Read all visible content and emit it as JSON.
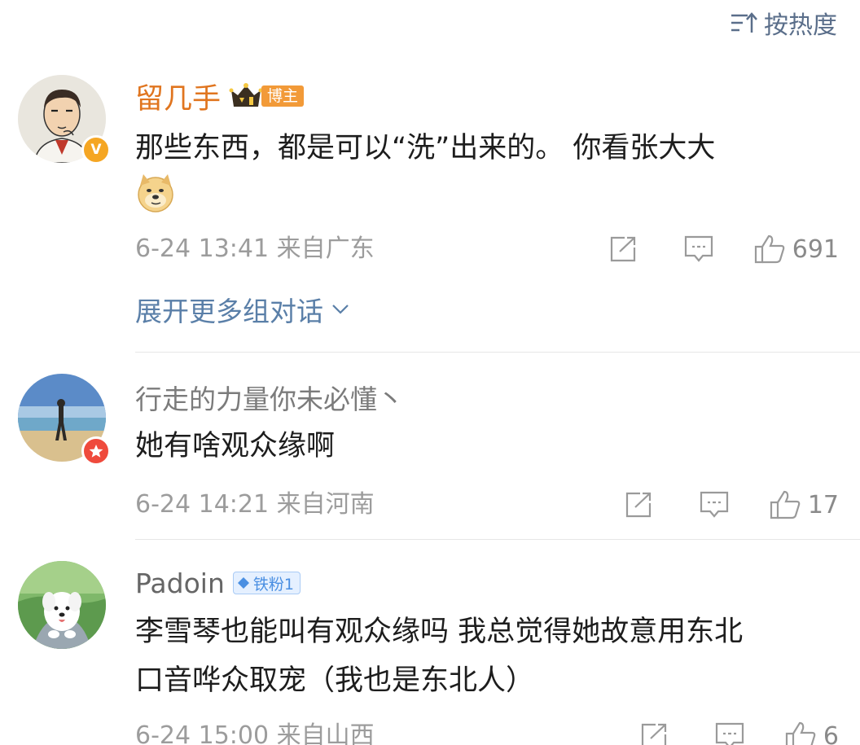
{
  "sort": {
    "label": "按热度",
    "icon": "sort-icon"
  },
  "comments": [
    {
      "author": "留几手",
      "host_badge": "博主",
      "text_line1": "那些东西，都是可以“洗”出来的。 你看张大大",
      "emoji": "doge-emoji",
      "time": "6-24 13:41",
      "location": "来自广东",
      "likes": "691",
      "avatar_badge": "V",
      "avatar_badge_color": "#f5a623",
      "expand": "展开更多组对话"
    },
    {
      "author": "行走的力量你未必懂丶",
      "text": "她有啥观众缘啊",
      "time": "6-24 14:21",
      "location": "来自河南",
      "likes": "17",
      "avatar_badge_color": "#ef4a3c"
    },
    {
      "author": "Padoin",
      "fan_badge": "铁粉1",
      "text_line1": "李雪琴也能叫有观众缘吗 我总觉得她故意用东北",
      "text_line2": "口音哗众取宠（我也是东北人）",
      "time": "6-24 15:00",
      "location": "来自山西",
      "likes": "6"
    }
  ],
  "colors": {
    "author_highlight": "#e0751f",
    "link": "#5a7fa8",
    "meta": "#9c9c9c",
    "text": "#1d1d1d"
  }
}
